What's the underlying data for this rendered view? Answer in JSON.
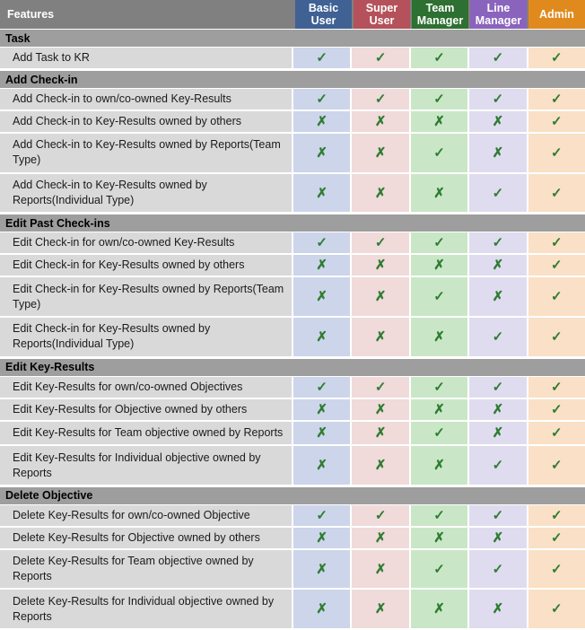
{
  "table": {
    "features_header": "Features",
    "columns": [
      {
        "id": "basic",
        "line1": "Basic",
        "line2": "User",
        "color": "#3f6194",
        "cell_color": "#ccd5ea"
      },
      {
        "id": "super",
        "line1": "Super",
        "line2": "User",
        "color": "#b5515a",
        "cell_color": "#f0dada"
      },
      {
        "id": "team",
        "line1": "Team",
        "line2": "Manager",
        "color": "#2e7031",
        "cell_color": "#c9e7c6"
      },
      {
        "id": "line",
        "line1": "Line",
        "line2": "Manager",
        "color": "#8a63bd",
        "cell_color": "#e0dcef"
      },
      {
        "id": "admin",
        "line1": "Admin",
        "line2": "",
        "color": "#e08a1e",
        "cell_color": "#fae0c6"
      }
    ],
    "marks": {
      "yes": "✓",
      "no": "✗"
    },
    "mark_color": "#2e7d32",
    "groups": [
      {
        "title": "Task",
        "rows": [
          {
            "label": "Add Task to KR",
            "values": [
              "yes",
              "yes",
              "yes",
              "yes",
              "yes"
            ],
            "tall": false
          }
        ]
      },
      {
        "title": "Add Check-in",
        "rows": [
          {
            "label": "Add Check-in to own/co-owned Key-Results",
            "values": [
              "yes",
              "yes",
              "yes",
              "yes",
              "yes"
            ],
            "tall": false
          },
          {
            "label": "Add Check-in to Key-Results owned by others",
            "values": [
              "no",
              "no",
              "no",
              "no",
              "yes"
            ],
            "tall": false
          },
          {
            "label": "Add Check-in to Key-Results owned by Reports(Team Type)",
            "values": [
              "no",
              "no",
              "yes",
              "no",
              "yes"
            ],
            "tall": true
          },
          {
            "label": "Add Check-in to Key-Results owned by Reports(Individual Type)",
            "values": [
              "no",
              "no",
              "no",
              "yes",
              "yes"
            ],
            "tall": true
          }
        ]
      },
      {
        "title": "Edit Past Check-ins",
        "rows": [
          {
            "label": "Edit Check-in for own/co-owned Key-Results",
            "values": [
              "yes",
              "yes",
              "yes",
              "yes",
              "yes"
            ],
            "tall": false
          },
          {
            "label": "Edit Check-in for Key-Results owned by others",
            "values": [
              "no",
              "no",
              "no",
              "no",
              "yes"
            ],
            "tall": false
          },
          {
            "label": "Edit Check-in for Key-Results owned by Reports(Team Type)",
            "values": [
              "no",
              "no",
              "yes",
              "no",
              "yes"
            ],
            "tall": true
          },
          {
            "label": "Edit Check-in for Key-Results owned by Reports(Individual Type)",
            "values": [
              "no",
              "no",
              "no",
              "yes",
              "yes"
            ],
            "tall": true
          }
        ]
      },
      {
        "title": "Edit Key-Results",
        "rows": [
          {
            "label": "Edit Key-Results for own/co-owned Objectives",
            "values": [
              "yes",
              "yes",
              "yes",
              "yes",
              "yes"
            ],
            "tall": false
          },
          {
            "label": "Edit Key-Results for Objective owned by others",
            "values": [
              "no",
              "no",
              "no",
              "no",
              "yes"
            ],
            "tall": false
          },
          {
            "label": "Edit Key-Results for Team objective owned by Reports",
            "values": [
              "no",
              "no",
              "yes",
              "no",
              "yes"
            ],
            "tall": true
          },
          {
            "label": "Edit Key-Results for Individual objective owned by Reports",
            "values": [
              "no",
              "no",
              "no",
              "yes",
              "yes"
            ],
            "tall": true
          }
        ]
      },
      {
        "title": "Delete Objective",
        "rows": [
          {
            "label": "Delete Key-Results for own/co-owned Objective",
            "values": [
              "yes",
              "yes",
              "yes",
              "yes",
              "yes"
            ],
            "tall": false
          },
          {
            "label": "Delete Key-Results for Objective owned by others",
            "values": [
              "no",
              "no",
              "no",
              "no",
              "yes"
            ],
            "tall": false
          },
          {
            "label": "Delete Key-Results for Team objective owned by Reports",
            "values": [
              "no",
              "no",
              "yes",
              "yes",
              "yes"
            ],
            "tall": true
          },
          {
            "label": "Delete Key-Results for Individual objective owned by Reports",
            "values": [
              "no",
              "no",
              "no",
              "no",
              "yes"
            ],
            "tall": true
          }
        ]
      }
    ]
  }
}
